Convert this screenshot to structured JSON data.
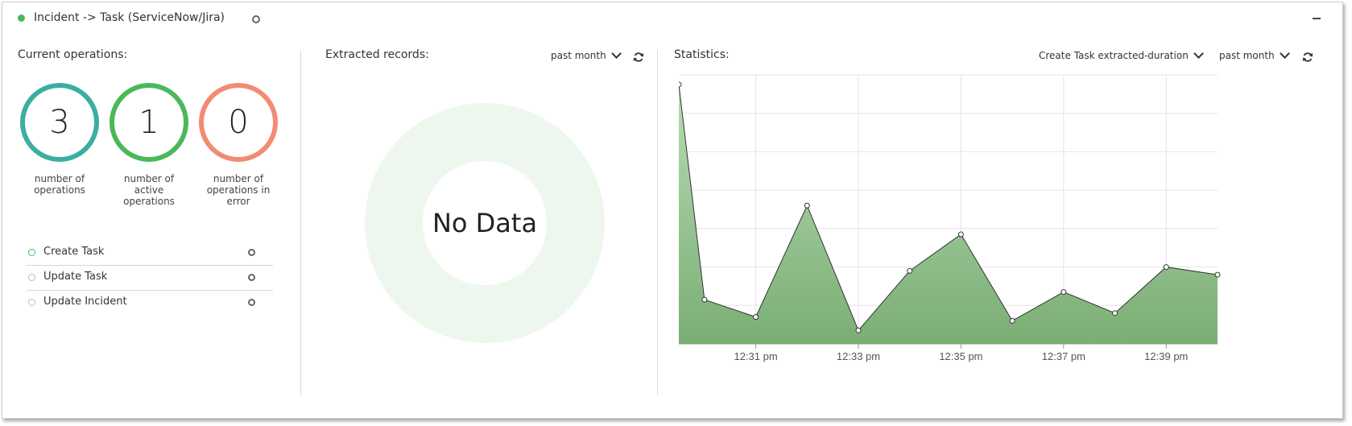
{
  "header": {
    "title": "Incident -> Task (ServiceNow/Jira)"
  },
  "current_operations": {
    "label": "Current operations:",
    "metrics": [
      {
        "value": "3",
        "caption": "number of operations",
        "color": "#3aafa0"
      },
      {
        "value": "1",
        "caption": "number of active operations",
        "color": "#4bb85a"
      },
      {
        "value": "0",
        "caption": "number of operations in error",
        "color": "#f28b74"
      }
    ],
    "operations": [
      {
        "name": "Create Task",
        "active": true
      },
      {
        "name": "Update Task",
        "active": false
      },
      {
        "name": "Update Incident",
        "active": false
      }
    ]
  },
  "extracted_records": {
    "label": "Extracted records:",
    "period": "past month",
    "empty_text": "No Data",
    "donut_color": "#eef7ee"
  },
  "statistics": {
    "label": "Statistics:",
    "metric_select": "Create Task extracted-duration",
    "period": "past month"
  },
  "chart_data": {
    "type": "area",
    "x": [
      "12:29:30",
      "12:30:00",
      "12:31:00",
      "12:32:00",
      "12:33:00",
      "12:34:00",
      "12:35:00",
      "12:36:00",
      "12:37:00",
      "12:38:00",
      "12:39:00",
      "12:40:00"
    ],
    "y": [
      1175,
      1063,
      1054,
      1112,
      1047,
      1078,
      1097,
      1052,
      1067,
      1056,
      1080,
      1076
    ],
    "x_ticks": [
      "12:31 pm",
      "12:33 pm",
      "12:35 pm",
      "12:37 pm",
      "12:39 pm"
    ],
    "y_ticks": [
      1040,
      1060,
      1080,
      1100,
      1120,
      1140,
      1160,
      1180
    ],
    "ylim": [
      1040,
      1180
    ],
    "grid": true,
    "fill_top": "#b8dcb4",
    "fill_bottom": "#7aae74",
    "line_color": "#333333"
  }
}
